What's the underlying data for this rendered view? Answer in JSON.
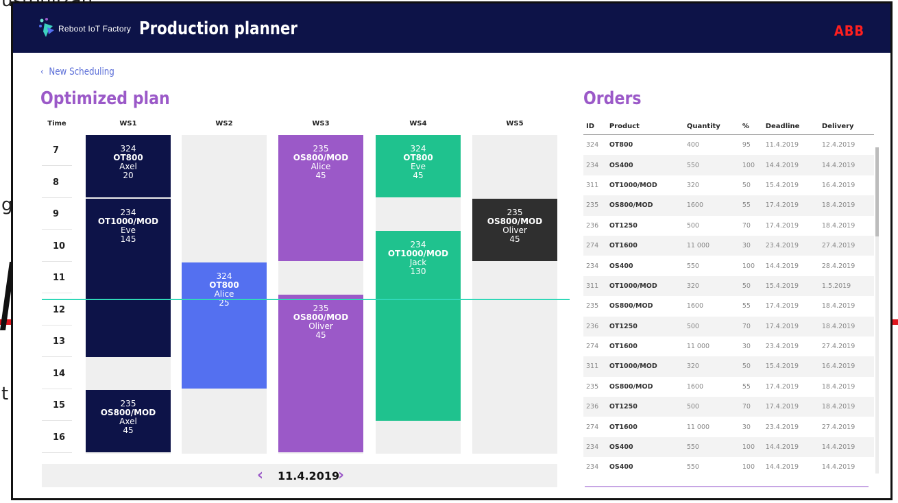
{
  "background": {
    "top_text": "ustoniizan",
    "left_text_1": "g",
    "left_text_2": "t"
  },
  "app": {
    "brand": "Reboot IoT Factory",
    "title": "Production planner",
    "vendor": "ABB",
    "back_link": "New Scheduling",
    "plan_title": "Optimized plan",
    "orders_title": "Orders"
  },
  "schedule": {
    "time_header": "Time",
    "workstations": [
      "WS1",
      "WS2",
      "WS3",
      "WS4",
      "WS5"
    ],
    "hours": [
      "7",
      "8",
      "9",
      "10",
      "11",
      "12",
      "13",
      "14",
      "15",
      "16"
    ],
    "blocks": [
      {
        "ws": 0,
        "start": 7,
        "end": 9,
        "id": "324",
        "product": "OT800",
        "worker": "Axel",
        "qty": "20",
        "color": "#0d1348"
      },
      {
        "ws": 0,
        "start": 9,
        "end": 14,
        "id": "234",
        "product": "OT1000/MOD",
        "worker": "Eve",
        "qty": "145",
        "color": "#0d1348"
      },
      {
        "ws": 0,
        "start": 15,
        "end": 17,
        "id": "235",
        "product": "OS800/MOD",
        "worker": "Axel",
        "qty": "45",
        "color": "#0d1348"
      },
      {
        "ws": 1,
        "start": 11,
        "end": 15,
        "id": "324",
        "product": "OT800",
        "worker": "Alice",
        "qty": "25",
        "color": "#5470f0"
      },
      {
        "ws": 2,
        "start": 7,
        "end": 11,
        "id": "235",
        "product": "OS800/MOD",
        "worker": "Alice",
        "qty": "45",
        "color": "#9b59c8"
      },
      {
        "ws": 2,
        "start": 12,
        "end": 17,
        "id": "235",
        "product": "OS800/MOD",
        "worker": "Oliver",
        "qty": "45",
        "color": "#9b59c8"
      },
      {
        "ws": 3,
        "start": 7,
        "end": 9,
        "id": "324",
        "product": "OT800",
        "worker": "Eve",
        "qty": "45",
        "color": "#1fc28e"
      },
      {
        "ws": 3,
        "start": 10,
        "end": 16,
        "id": "234",
        "product": "OT1000/MOD",
        "worker": "Jack",
        "qty": "130",
        "color": "#1fc28e"
      },
      {
        "ws": 4,
        "start": 9,
        "end": 11,
        "id": "235",
        "product": "OS800/MOD",
        "worker": "Oliver",
        "qty": "45",
        "color": "#2f2f2f"
      }
    ],
    "date": "11.4.2019"
  },
  "orders": {
    "columns": [
      "ID",
      "Product",
      "Quantity",
      "%",
      "Deadline",
      "Delivery"
    ],
    "rows": [
      [
        "324",
        "OT800",
        "400",
        "95",
        "11.4.2019",
        "12.4.2019"
      ],
      [
        "234",
        "OS400",
        "550",
        "100",
        "14.4.2019",
        "14.4.2019"
      ],
      [
        "311",
        "OT1000/MOD",
        "320",
        "50",
        "15.4.2019",
        "16.4.2019"
      ],
      [
        "235",
        "OS800/MOD",
        "1600",
        "55",
        "17.4.2019",
        "18.4.2019"
      ],
      [
        "236",
        "OT1250",
        "500",
        "70",
        "17.4.2019",
        "18.4.2019"
      ],
      [
        "274",
        "OT1600",
        "11 000",
        "30",
        "23.4.2019",
        "27.4.2019"
      ],
      [
        "234",
        "OS400",
        "550",
        "100",
        "14.4.2019",
        "28.4.2019"
      ],
      [
        "311",
        "OT1000/MOD",
        "320",
        "50",
        "15.4.2019",
        "1.5.2019"
      ],
      [
        "235",
        "OS800/MOD",
        "1600",
        "55",
        "17.4.2019",
        "18.4.2019"
      ],
      [
        "236",
        "OT1250",
        "500",
        "70",
        "17.4.2019",
        "18.4.2019"
      ],
      [
        "274",
        "OT1600",
        "11 000",
        "30",
        "23.4.2019",
        "27.4.2019"
      ],
      [
        "311",
        "OT1000/MOD",
        "320",
        "50",
        "15.4.2019",
        "16.4.2019"
      ],
      [
        "235",
        "OS800/MOD",
        "1600",
        "55",
        "17.4.2019",
        "18.4.2019"
      ],
      [
        "236",
        "OT1250",
        "500",
        "70",
        "17.4.2019",
        "18.4.2019"
      ],
      [
        "274",
        "OT1600",
        "11 000",
        "30",
        "23.4.2019",
        "27.4.2019"
      ],
      [
        "234",
        "OS400",
        "550",
        "100",
        "14.4.2019",
        "14.4.2019"
      ],
      [
        "234",
        "OS400",
        "550",
        "100",
        "14.4.2019",
        "14.4.2019"
      ]
    ]
  }
}
